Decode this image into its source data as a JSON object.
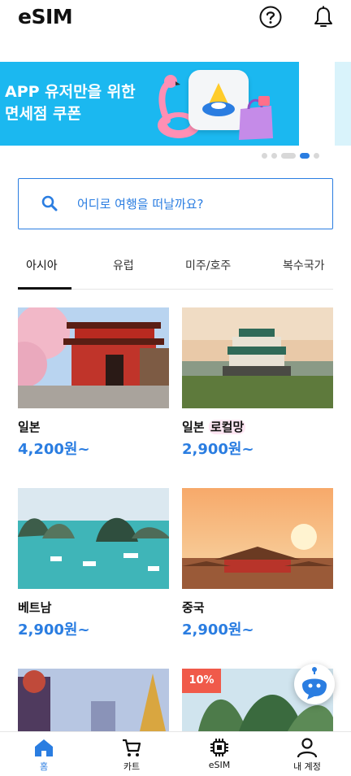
{
  "header": {
    "logo": "eSIM",
    "help_icon": "help-circle-icon",
    "bell_icon": "bell-icon"
  },
  "banner": {
    "line1": "APP 유저만을 위한",
    "line2": "면세점 쿠폰",
    "slide_index": 4,
    "slide_count": 5
  },
  "search": {
    "placeholder": "어디로 여행을 떠날까요?"
  },
  "tabs": [
    {
      "label": "아시아",
      "active": true
    },
    {
      "label": "유럽",
      "active": false
    },
    {
      "label": "미주/호주",
      "active": false
    },
    {
      "label": "복수국가",
      "active": false
    }
  ],
  "products": [
    {
      "name": "일본",
      "tag": "",
      "price": "4,200원~"
    },
    {
      "name": "일본",
      "tag": "로컬망",
      "price": "2,900원~"
    },
    {
      "name": "베트남",
      "tag": "",
      "price": "2,900원~"
    },
    {
      "name": "중국",
      "tag": "",
      "price": "2,900원~"
    },
    {
      "name": "",
      "tag": "",
      "price": ""
    },
    {
      "name": "",
      "tag": "",
      "price": "",
      "badge": "10%"
    }
  ],
  "bottom_nav": [
    {
      "label": "홈",
      "icon": "home-icon",
      "active": true
    },
    {
      "label": "카트",
      "icon": "cart-icon",
      "active": false
    },
    {
      "label": "eSIM",
      "icon": "chip-icon",
      "active": false
    },
    {
      "label": "내 계정",
      "icon": "user-icon",
      "active": false
    }
  ],
  "colors": {
    "accent": "#2a7de1",
    "banner_bg": "#1bb8f0",
    "badge": "#f05a4a"
  }
}
